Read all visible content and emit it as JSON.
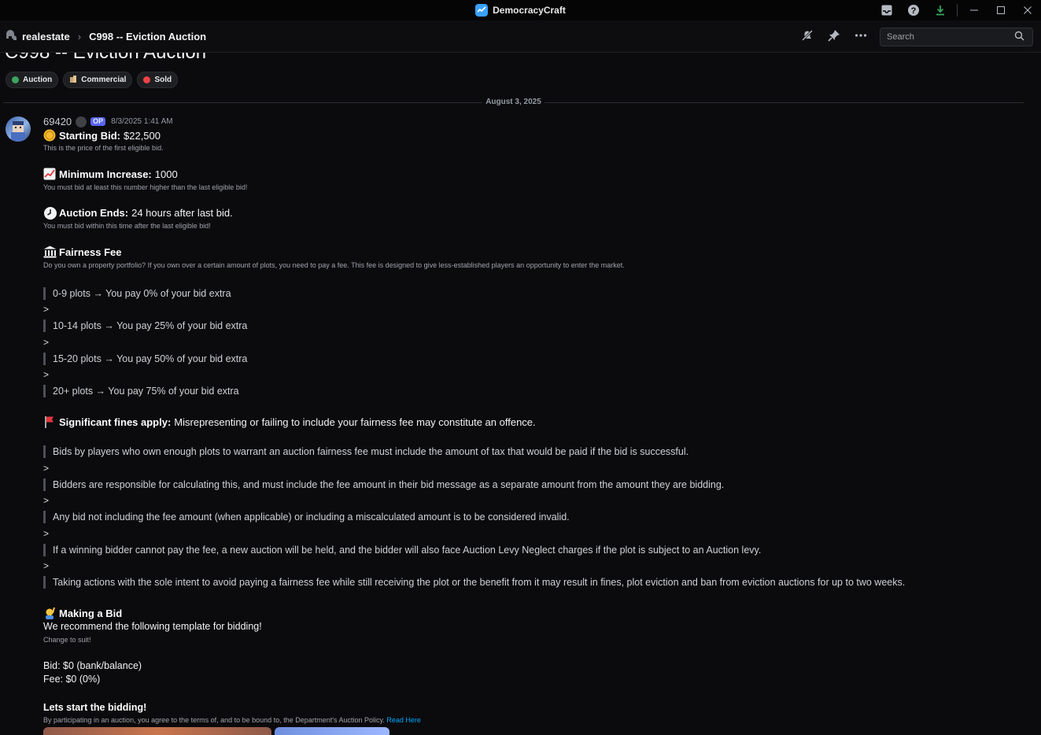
{
  "titlebar": {
    "app_name": "DemocracyCraft",
    "icons": [
      "inbox-icon",
      "help-icon",
      "download-icon",
      "minimize-icon",
      "maximize-icon",
      "close-icon"
    ]
  },
  "header": {
    "channel": "realestate",
    "thread": "C998 -- Eviction Auction",
    "search_placeholder": "Search"
  },
  "post": {
    "title": "C998 -- Eviction Auction",
    "tags": [
      {
        "label": "Auction",
        "color": "#3ba55d"
      },
      {
        "label": "Commercial",
        "icon": "building-icon"
      },
      {
        "label": "Sold",
        "color": "#ed4245"
      }
    ],
    "date_divider": "August 3, 2025"
  },
  "message": {
    "author": "69420",
    "op_badge": "OP",
    "timestamp": "8/3/2025 1:41 AM",
    "starting_bid": {
      "label": "Starting Bid:",
      "value": "$22,500",
      "note": "This is the price of the first eligible bid."
    },
    "min_increase": {
      "label": "Minimum Increase:",
      "value": "1000",
      "note": "You must bid at least this number higher than the last eligible bid!"
    },
    "auction_ends": {
      "label": "Auction Ends:",
      "value": "24 hours after last bid.",
      "note": "You must bid within this time after the last eligible bid!"
    },
    "fairness_fee": {
      "label": "Fairness Fee",
      "note": "Do you own a property portfolio? If you own over a certain amount of plots, you need to pay a fee. This fee is designed to give less-established players an opportunity to enter the market.",
      "tiers": [
        "0-9 plots → You pay 0% of your bid extra",
        "10-14 plots → You pay 25% of your bid extra",
        "15-20 plots → You pay 50% of your bid extra",
        "20+ plots → You pay 75% of your bid extra"
      ]
    },
    "fines": {
      "label": "Significant fines apply:",
      "text": "Misrepresenting or failing to include your fairness fee may constitute an offence.",
      "items": [
        "Bids by players who own enough plots to warrant an auction fairness fee must include the amount of tax that would be paid if the bid is successful.",
        "Bidders are responsible for calculating this, and must include the fee amount in their bid message as a separate amount from the amount they are bidding.",
        "Any bid not including the fee amount (when applicable) or including a miscalculated amount is to be considered invalid.",
        "If a winning bidder cannot pay the fee, a new auction will be held, and the bidder will also face Auction Levy Neglect charges if the plot is subject to an Auction levy.",
        "Taking actions with the sole intent to avoid paying a fairness fee while still receiving the plot or the benefit from it may result in fines, plot eviction and ban from eviction auctions for up to two weeks."
      ],
      "separator": ">"
    },
    "making_bid": {
      "label": "Making a Bid",
      "text": "We recommend the following template for bidding!",
      "note": "Change to suit!",
      "bid_line": "Bid: $0 (bank/balance)",
      "fee_line": "Fee: $0 (0%)"
    },
    "start": {
      "label": "Lets start the bidding!",
      "text": "By participating in an auction, you agree to the terms of, and to be bound to, the Department's Auction Policy.",
      "link": "Read Here"
    }
  }
}
